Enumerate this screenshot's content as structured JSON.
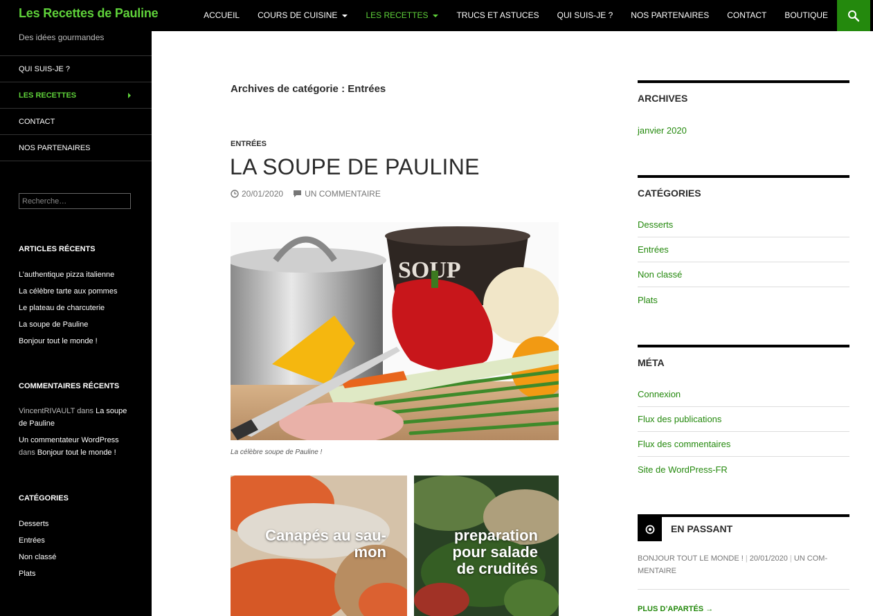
{
  "site": {
    "title": "Les Recettes de Pauline",
    "tagline": "Des idées gourmandes"
  },
  "topnav": [
    {
      "label": "ACCUEIL"
    },
    {
      "label": "COURS DE CUISINE",
      "dropdown": true
    },
    {
      "label": "LES RECETTES",
      "dropdown": true,
      "active": true
    },
    {
      "label": "TRUCS ET ASTUCES"
    },
    {
      "label": "QUI SUIS-JE ?"
    },
    {
      "label": "NOS PARTENAIRES"
    },
    {
      "label": "CONTACT"
    },
    {
      "label": "BOUTIQUE"
    }
  ],
  "sidebar": {
    "nav": [
      {
        "label": "QUI SUIS-JE ?"
      },
      {
        "label": "LES RECETTES",
        "active": true
      },
      {
        "label": "CONTACT"
      },
      {
        "label": "NOS PARTENAIRES"
      }
    ],
    "search_placeholder": "Recherche…",
    "recent_posts_title": "ARTICLES RÉCENTS",
    "recent_posts": [
      "L’authentique pizza italienne",
      "La célèbre tarte aux pommes",
      "Le plateau de charcuterie",
      "La soupe de Pauline",
      "Bonjour tout le monde !"
    ],
    "recent_comments_title": "COMMENTAIRES RÉCENTS",
    "recent_comments": [
      {
        "author": "VincentRIVAULT",
        "dans": "dans",
        "post": "La soupe de Pauline"
      },
      {
        "author": "Un commentateur WordPress",
        "dans": "dans",
        "post": "Bonjour tout le monde !"
      }
    ],
    "categories_title": "CATÉGORIES",
    "categories": [
      "Desserts",
      "Entrées",
      "Non classé",
      "Plats"
    ]
  },
  "main": {
    "archive_title": "Archives de catégorie : Entrées",
    "post": {
      "category": "ENTRÉES",
      "title": "LA SOUPE DE PAULINE",
      "date": "20/01/2020",
      "comments": "UN COMMENTAIRE",
      "image_pot_text": "SOUP",
      "caption": "La célèbre soupe de Pauline !"
    },
    "tiles": [
      {
        "title_line1": "Canapés au sau-",
        "title_line2": "mon"
      },
      {
        "title_line1": "preparation",
        "title_line2": "pour salade",
        "title_line3": "de crudités"
      }
    ]
  },
  "right": {
    "archives_title": "ARCHIVES",
    "archives": [
      "janvier 2020"
    ],
    "categories_title": "CATÉGORIES",
    "categories": [
      "Desserts",
      "Entrées",
      "Non classé",
      "Plats"
    ],
    "meta_title": "MÉTA",
    "meta": [
      "Connexion",
      "Flux des publications",
      "Flux des commentaires",
      "Site de WordPress-FR"
    ],
    "en_passant": {
      "title": "EN PASSANT",
      "post": "BONJOUR TOUT LE MONDE !",
      "date": "20/01/2020",
      "comment_line1": "UN COM-",
      "comment_line2": "MENTAIRE",
      "more": "PLUS D’APARTÉS →"
    }
  },
  "colors": {
    "accent": "#24890d",
    "accent_light": "#5fd23a",
    "header_bg": "#000000"
  }
}
